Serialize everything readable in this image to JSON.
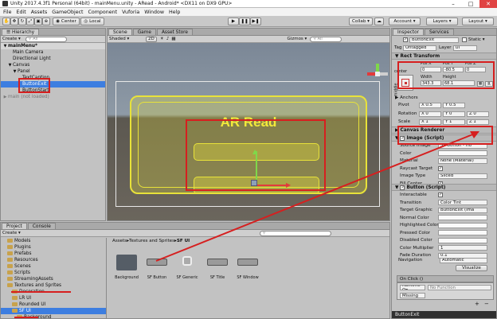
{
  "window": {
    "title": "Unity 2017.4.3f1 Personal (64bit) - mainMenu.unity - ARead - Android* <DX11 on DX9 GPU>"
  },
  "menu": [
    "File",
    "Edit",
    "Assets",
    "GameObject",
    "Component",
    "Vuforia",
    "Window",
    "Help"
  ],
  "toolbar": {
    "center_label": "Center",
    "local_label": "Local",
    "collab_label": "Collab ▾",
    "account_label": "Account ▾",
    "layers_label": "Layers ▾",
    "layout_label": "Layout ▾"
  },
  "hierarchy": {
    "tab": "Hierarchy",
    "create": "Create ▾",
    "search_placeholder": "All",
    "items": [
      {
        "label": "mainMenu*",
        "indent": 0,
        "arrow": "▼",
        "cls": "hdr"
      },
      {
        "label": "Main Camera",
        "indent": 1,
        "arrow": "",
        "cls": ""
      },
      {
        "label": "Directional Light",
        "indent": 1,
        "arrow": "",
        "cls": ""
      },
      {
        "label": "Canvas",
        "indent": 1,
        "arrow": "▼",
        "cls": ""
      },
      {
        "label": "Panel",
        "indent": 2,
        "arrow": "▼",
        "cls": ""
      },
      {
        "label": "TextCaption",
        "indent": 3,
        "arrow": "",
        "cls": ""
      },
      {
        "label": "ButtonExit",
        "indent": 3,
        "arrow": "",
        "cls": "sel"
      },
      {
        "label": "ButtonStart",
        "indent": 3,
        "arrow": "",
        "cls": ""
      },
      {
        "label": "main (not loaded)",
        "indent": 0,
        "arrow": "▶",
        "cls": "dim"
      }
    ]
  },
  "scene": {
    "tabs": [
      "Scene",
      "Game",
      "Asset Store"
    ],
    "shaded": "Shaded ▾",
    "mode2d": "2D",
    "gizmos": "Gizmos ▾",
    "search_placeholder": "All",
    "title_text": "AR Read"
  },
  "project": {
    "tabs": [
      "Project",
      "Console"
    ],
    "create": "Create ▾",
    "breadcrumb": [
      "Assets",
      "Textures and Sprites",
      "SF UI"
    ],
    "tree": [
      {
        "label": "Models",
        "indent": 1,
        "cls": ""
      },
      {
        "label": "Plugins",
        "indent": 1,
        "cls": ""
      },
      {
        "label": "Prefabs",
        "indent": 1,
        "cls": ""
      },
      {
        "label": "Resources",
        "indent": 1,
        "cls": ""
      },
      {
        "label": "Scenes",
        "indent": 1,
        "cls": ""
      },
      {
        "label": "Scripts",
        "indent": 1,
        "cls": ""
      },
      {
        "label": "StreamingAssets",
        "indent": 1,
        "cls": ""
      },
      {
        "label": "Textures and Sprites",
        "indent": 1,
        "cls": ""
      },
      {
        "label": "Decoration",
        "indent": 2,
        "cls": ""
      },
      {
        "label": "LR UI",
        "indent": 2,
        "cls": ""
      },
      {
        "label": "Rounded UI",
        "indent": 2,
        "cls": ""
      },
      {
        "label": "SF UI",
        "indent": 2,
        "cls": "sel"
      },
      {
        "label": "Background",
        "indent": 3,
        "cls": ""
      }
    ],
    "assets": [
      {
        "label": "Background",
        "kind": "folder"
      },
      {
        "label": "SF Button",
        "kind": "button"
      },
      {
        "label": "SF Generic",
        "kind": "generic"
      },
      {
        "label": "SF Title",
        "kind": "title"
      },
      {
        "label": "SF Window",
        "kind": "window"
      }
    ]
  },
  "inspector": {
    "tabs": [
      "Inspector",
      "Services"
    ],
    "name": "ButtonExit",
    "static_label": "Static ▾",
    "tag_label": "Tag",
    "tag_value": "Untagged",
    "layer_label": "Layer",
    "layer_value": "UI",
    "rect": {
      "header": "Rect Transform",
      "anchor_h": "center",
      "anchor_v": "middle",
      "pos_labels": [
        "Pos X",
        "Pos Y",
        "Pos Z"
      ],
      "pos_values": [
        "0",
        "-80.5",
        "0"
      ],
      "size_labels": [
        "Width",
        "Height"
      ],
      "size_values": [
        "343.3",
        "68.1"
      ],
      "r_btn": "R",
      "anchors": "Anchors",
      "pivot_label": "Pivot",
      "pivot": [
        "X 0.5",
        "Y 0.5"
      ],
      "rotation_label": "Rotation",
      "rotation": [
        "X 0",
        "Y 0",
        "Z 0"
      ],
      "scale_label": "Scale",
      "scale": [
        "X 1",
        "Y 1",
        "Z 1"
      ]
    },
    "canvas_renderer": "Canvas Renderer",
    "image": {
      "header": "Image (Script)",
      "fields": [
        {
          "label": "Source Image",
          "value": "SF Button - Ho"
        },
        {
          "label": "Color",
          "value": ""
        },
        {
          "label": "Material",
          "value": "None (Material)"
        },
        {
          "label": "Raycast Target",
          "value": "✓"
        },
        {
          "label": "Image Type",
          "value": "Sliced"
        },
        {
          "label": "Fill Center",
          "value": "✓"
        }
      ]
    },
    "button": {
      "header": "Button (Script)",
      "fields": [
        {
          "label": "Interactable",
          "value": "✓"
        },
        {
          "label": "Transition",
          "value": "Color Tint"
        },
        {
          "label": "Target Graphic",
          "value": "ButtonExit (Ima"
        },
        {
          "label": "Normal Color",
          "value": ""
        },
        {
          "label": "Highlighted Color",
          "value": ""
        },
        {
          "label": "Pressed Color",
          "value": ""
        },
        {
          "label": "Disabled Color",
          "value": ""
        },
        {
          "label": "Color Multiplier",
          "value": "1"
        },
        {
          "label": "Fade Duration",
          "value": "0.1"
        }
      ],
      "navigation_label": "Navigation",
      "navigation_value": "Automatic",
      "visualize": "Visualize",
      "onclick": "On Click ()",
      "runtime": "Runtime O▾",
      "function": "No Function",
      "missing": "Missing"
    },
    "footer": "ButtonExit"
  },
  "colors": {
    "selection": "#3d7ee0",
    "highlight_red": "#d61f1f",
    "ui_yellow": "#e8e23a"
  }
}
